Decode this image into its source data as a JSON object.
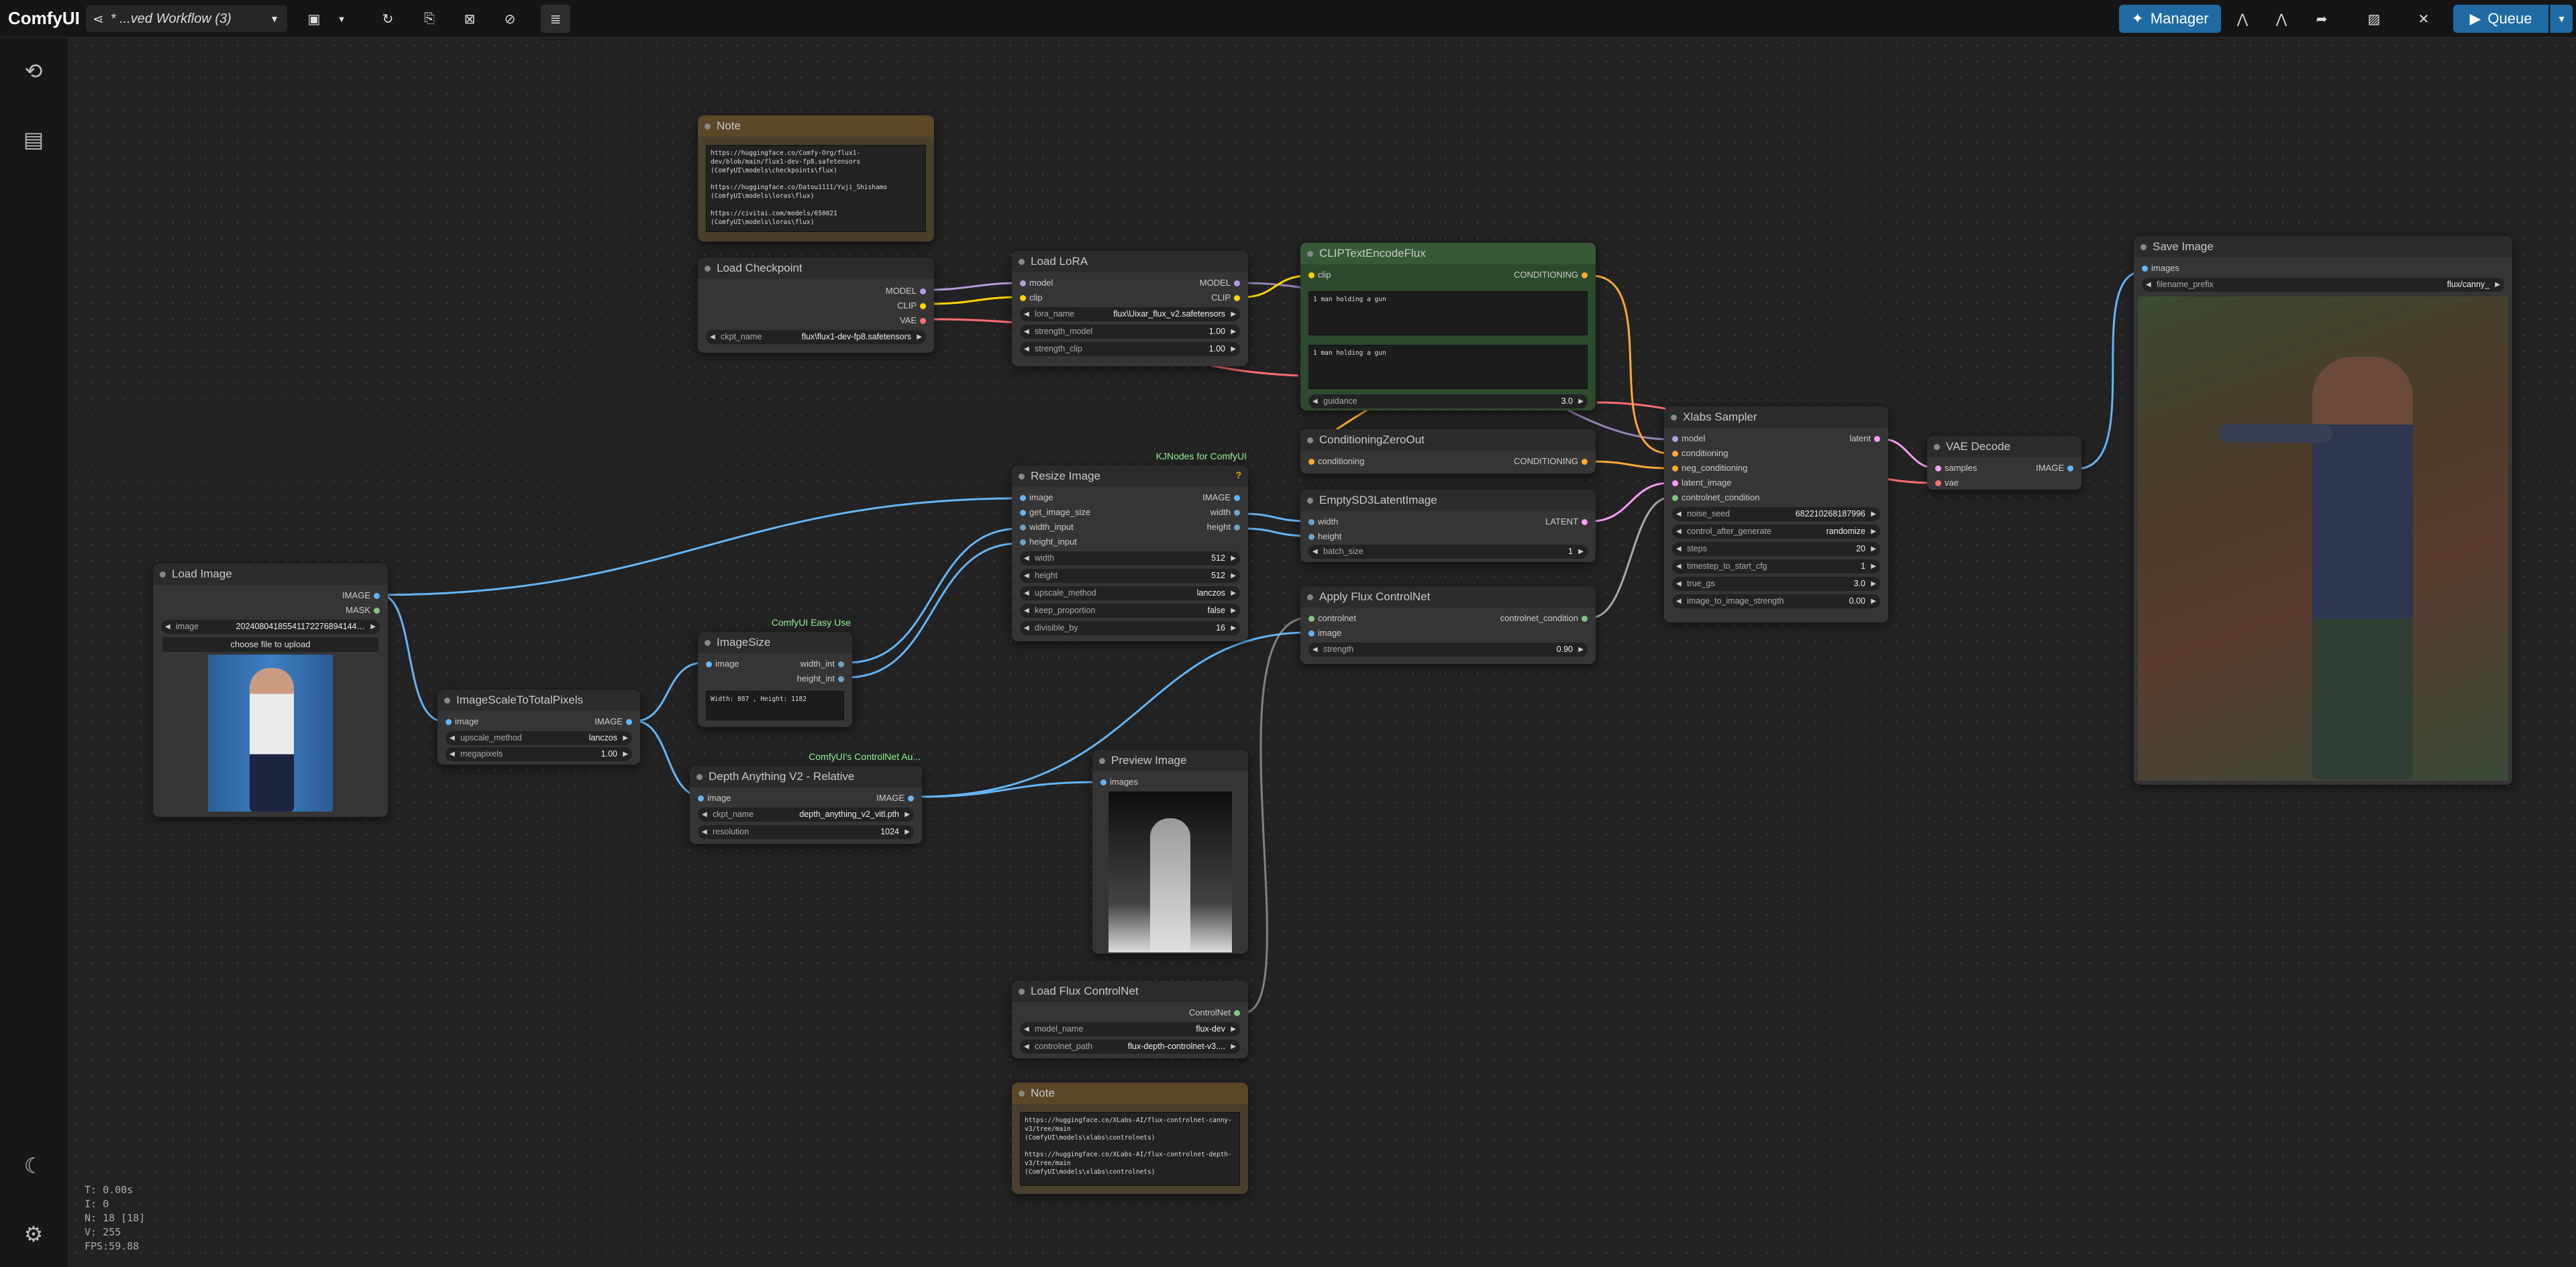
{
  "app": {
    "logo": "ComfyUI",
    "workflow": "* ...ved Workflow (3)",
    "manager": "Manager",
    "queue": "Queue"
  },
  "colors": {
    "model": "#b39ddb",
    "clip": "#ffd500",
    "vae": "#ff6e6e",
    "image": "#64b5f6",
    "cond": "#ffa931",
    "latent": "#ff9cf9",
    "mask": "#81c784"
  },
  "stats": {
    "t": "T: 0.00s",
    "i": "I: 0",
    "n": "N: 18 [18]",
    "v": "V: 255",
    "fps": "FPS:59.88"
  },
  "nodes": {
    "note1": {
      "title": "Note",
      "text": "https://huggingface.co/Comfy-Org/flux1-dev/blob/main/flux1-dev-fp8.safetensors\n(ComfyUI\\models\\checkpoints\\flux)\n\nhttps://huggingface.co/Datou1111/Yuji_Shishamo\n(ComfyUI\\models\\loras\\flux)\n\nhttps://civitai.com/models/650021\n(ComfyUI\\models\\loras\\flux)"
    },
    "ckpt": {
      "title": "Load Checkpoint",
      "out_model": "MODEL",
      "out_clip": "CLIP",
      "out_vae": "VAE",
      "w_label": "ckpt_name",
      "w_value": "flux\\flux1-dev-fp8.safetensors"
    },
    "lora": {
      "title": "Load LoRA",
      "in_model": "model",
      "in_clip": "clip",
      "out_model": "MODEL",
      "out_clip": "CLIP",
      "w1_l": "lora_name",
      "w1_v": "flux\\Uixar_flux_v2.safetensors",
      "w2_l": "strength_model",
      "w2_v": "1.00",
      "w3_l": "strength_clip",
      "w3_v": "1.00"
    },
    "clipenc": {
      "title": "CLIPTextEncodeFlux",
      "in_clip": "clip",
      "out": "CONDITIONING",
      "text1": "1 man holding a gun",
      "text2": "1 man holding a gun",
      "w_l": "guidance",
      "w_v": "3.0"
    },
    "condzero": {
      "title": "ConditioningZeroOut",
      "in": "conditioning",
      "out": "CONDITIONING"
    },
    "xlabs": {
      "title": "Xlabs Sampler",
      "in1": "model",
      "in2": "conditioning",
      "in3": "neg_conditioning",
      "in4": "latent_image",
      "in5": "controlnet_condition",
      "out": "latent",
      "w1_l": "noise_seed",
      "w1_v": "682210268187996",
      "w2_l": "control_after_generate",
      "w2_v": "randomize",
      "w3_l": "steps",
      "w3_v": "20",
      "w4_l": "timestep_to_start_cfg",
      "w4_v": "1",
      "w5_l": "true_gs",
      "w5_v": "3.0",
      "w6_l": "image_to_image_strength",
      "w6_v": "0.00"
    },
    "vaedecode": {
      "title": "VAE Decode",
      "in1": "samples",
      "in2": "vae",
      "out": "IMAGE"
    },
    "save": {
      "title": "Save Image",
      "in": "images",
      "w_l": "filename_prefix",
      "w_v": "flux/canny_"
    },
    "resize": {
      "title": "Resize Image",
      "badge": "KJNodes for ComfyUI",
      "help": "?",
      "in1": "image",
      "in2": "get_image_size",
      "in3": "width_input",
      "in4": "height_input",
      "out1": "IMAGE",
      "out2": "width",
      "out3": "height",
      "w1_l": "width",
      "w1_v": "512",
      "w2_l": "height",
      "w2_v": "512",
      "w3_l": "upscale_method",
      "w3_v": "lanczos",
      "w4_l": "keep_proportion",
      "w4_v": "false",
      "w5_l": "divisible_by",
      "w5_v": "16"
    },
    "emptylatent": {
      "title": "EmptySD3LatentImage",
      "in1": "width",
      "in2": "height",
      "out": "LATENT",
      "w_l": "batch_size",
      "w_v": "1"
    },
    "applycn": {
      "title": "Apply Flux ControlNet",
      "in1": "controlnet",
      "in2": "image",
      "out": "controlnet_condition",
      "w_l": "strength",
      "w_v": "0.90"
    },
    "loadimg": {
      "title": "Load Image",
      "out1": "IMAGE",
      "out2": "MASK",
      "w_l": "image",
      "w_v": "20240804185541172276894144…",
      "upload": "choose file to upload"
    },
    "scale": {
      "title": "ImageScaleToTotalPixels",
      "in": "image",
      "out": "IMAGE",
      "w1_l": "upscale_method",
      "w1_v": "lanczos",
      "w2_l": "megapixels",
      "w2_v": "1.00"
    },
    "imgsize": {
      "title": "ImageSize",
      "badge": "ComfyUI Easy Use",
      "in": "image",
      "out1": "width_int",
      "out2": "height_int",
      "text": "Width: 887 , Height: 1182"
    },
    "depth": {
      "title": "Depth Anything V2 - Relative",
      "badge": "ComfyUI's ControlNet Au...",
      "in": "image",
      "out": "IMAGE",
      "w1_l": "ckpt_name",
      "w1_v": "depth_anything_v2_vitl.pth",
      "w2_l": "resolution",
      "w2_v": "1024"
    },
    "preview": {
      "title": "Preview Image",
      "in": "images"
    },
    "loadcn": {
      "title": "Load Flux ControlNet",
      "out": "ControlNet",
      "w1_l": "model_name",
      "w1_v": "flux-dev",
      "w2_l": "controlnet_path",
      "w2_v": "flux-depth-controlnet-v3...."
    },
    "note2": {
      "title": "Note",
      "text": "https://huggingface.co/XLabs-AI/flux-controlnet-canny-v3/tree/main\n(ComfyUI\\models\\xlabs\\controlnets)\n\nhttps://huggingface.co/XLabs-AI/flux-controlnet-depth-v3/tree/main\n(ComfyUI\\models\\xlabs\\controlnets)"
    }
  }
}
